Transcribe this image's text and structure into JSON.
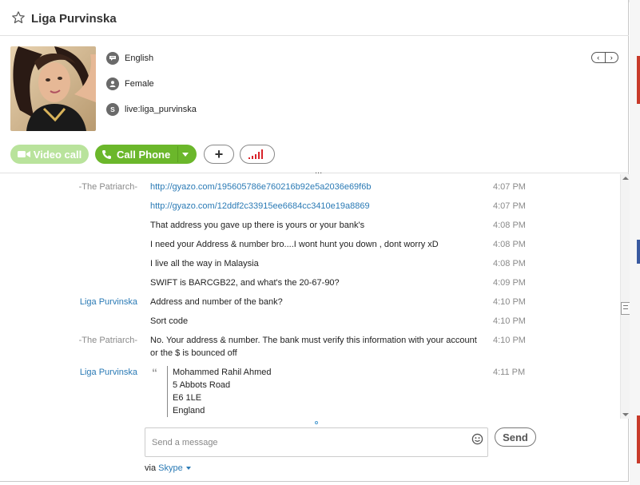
{
  "contact": {
    "name": "Liga Purvinska",
    "language": "English",
    "gender": "Female",
    "skype_id": "live:liga_purvinska"
  },
  "nav": {
    "prev": "‹",
    "next": "›"
  },
  "actions": {
    "video_call": "Video call",
    "call_phone": "Call Phone",
    "add": "+"
  },
  "messages": [
    {
      "sender": "-The Patriarch-",
      "lines": [
        "http://gyazo.com/195605786e760216b92e5a2036e69f6b"
      ],
      "time": "4:07 PM",
      "link": true
    },
    {
      "sender": "",
      "lines": [
        "http://gyazo.com/12ddf2c33915ee6684cc3410e19a8869"
      ],
      "time": "4:07 PM",
      "link": true
    },
    {
      "sender": "",
      "lines": [
        "That address you gave up there is yours or your bank's"
      ],
      "time": "4:08 PM"
    },
    {
      "sender": "",
      "lines": [
        "I need your Address & number bro....I wont hunt you down , dont worry xD"
      ],
      "time": "4:08 PM"
    },
    {
      "sender": "",
      "lines": [
        "I live all the way in Malaysia"
      ],
      "time": "4:08 PM"
    },
    {
      "sender": "",
      "lines": [
        "SWIFT is BARCGB22, and what's the 20-67-90?"
      ],
      "time": "4:09 PM"
    },
    {
      "sender": "Liga Purvinska",
      "lines": [
        "Address and number of the bank?"
      ],
      "time": "4:10 PM"
    },
    {
      "sender": "",
      "lines": [
        "Sort code"
      ],
      "time": "4:10 PM"
    },
    {
      "sender": "-The Patriarch-",
      "lines": [
        "No. Your address & number. The bank must verify this information with your account",
        "or the $ is bounced off"
      ],
      "time": "4:10 PM"
    },
    {
      "sender": "Liga Purvinska",
      "quote": [
        "Mohammed Rahil Ahmed",
        "5 Abbots Road",
        "E6 1LE",
        "England"
      ],
      "time": "4:11 PM"
    }
  ],
  "compose": {
    "placeholder": "Send a message",
    "send_label": "Send",
    "via_label": "via",
    "via_service": "Skype"
  },
  "colors": {
    "call_green": "#6bb72b",
    "video_green_disabled": "#b9e39c",
    "link_blue": "#2a7ab5",
    "signal_red": "#d8232a"
  }
}
